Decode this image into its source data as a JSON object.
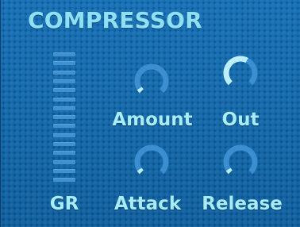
{
  "panel": {
    "title": "COMPRESSOR",
    "gr_meter": {
      "label": "GR",
      "segments": 15,
      "active_segments": 0
    },
    "knobs": [
      {
        "id": "amount",
        "label": "Amount",
        "value": 0.05
      },
      {
        "id": "out",
        "label": "Out",
        "value": 0.6
      },
      {
        "id": "attack",
        "label": "Attack",
        "value": 0.05
      },
      {
        "id": "release",
        "label": "Release",
        "value": 0.05
      }
    ]
  },
  "colors": {
    "background": "#1264a6",
    "title": "#8fe0f2",
    "label": "#a8ecf8",
    "knob_track": "#3b8fd0",
    "knob_value": "#bdeefc",
    "meter_segment": "#3f92cf"
  }
}
